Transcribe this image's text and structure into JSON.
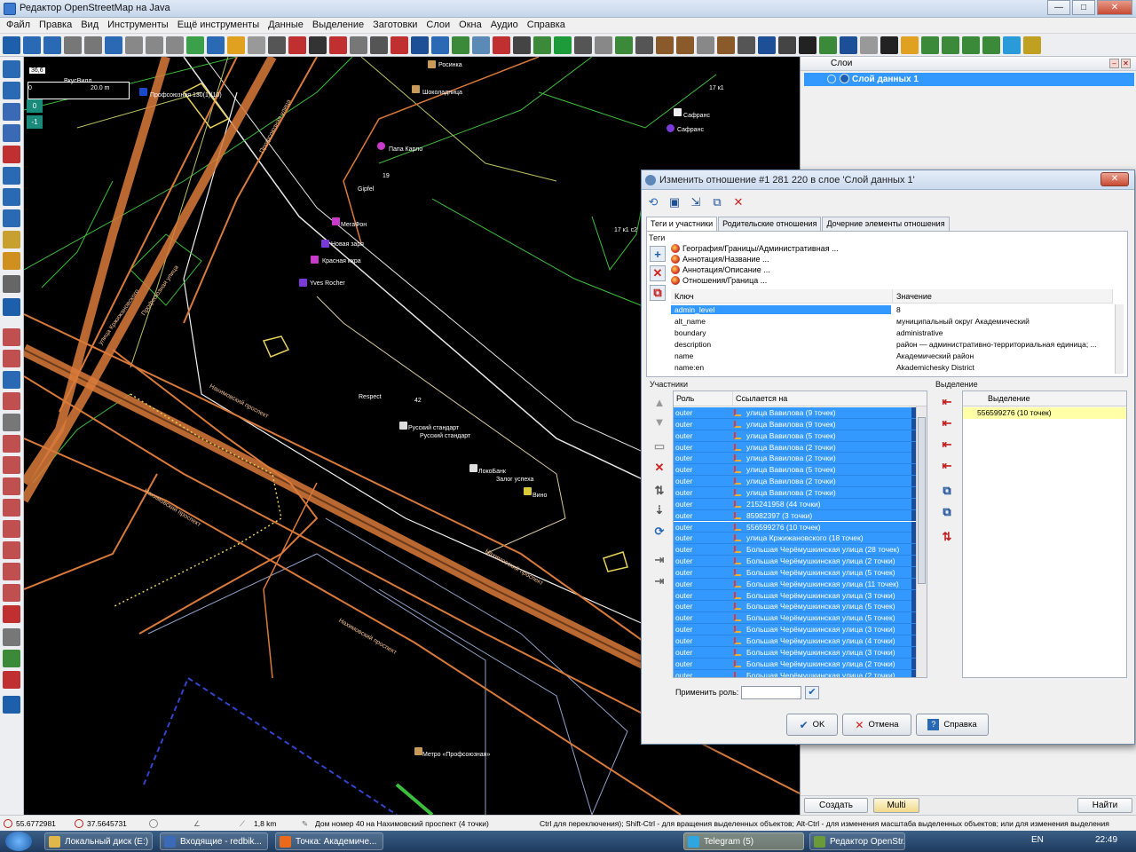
{
  "window": {
    "title": "Редактор OpenStreetMap на Java"
  },
  "menu": [
    "Файл",
    "Правка",
    "Вид",
    "Инструменты",
    "Ещё инструменты",
    "Данные",
    "Выделение",
    "Заготовки",
    "Слои",
    "Окна",
    "Аудио",
    "Справка"
  ],
  "map": {
    "scale_value": "36,6",
    "scale_zero": "0",
    "scale_len": "20.0 m",
    "zoom_in": "0",
    "zoom_out": "-1",
    "labels": {
      "vkusville": "ВкусВилл",
      "profsoyuznaya": "Профсоюзная 130(1)(10)",
      "rosinka": "Росинка",
      "shokoladnitsa": "Шоколадница",
      "papa_karlo": "Папа Карло",
      "n19": "19",
      "gipfel": "Gipfel",
      "megafon": "МегаФон",
      "novaya_zarya": "Новая заря",
      "krasnaya_ikra": "Красная икра",
      "yves_rocher": "Yves Rocher",
      "respect": "Respect",
      "n42": "42",
      "russkiy1": "Русский стандарт",
      "russkiy2": "Русский стандарт",
      "lokobank": "ЛокоБанк",
      "zalog": "Залог успеха",
      "vino": "Вино",
      "safrans1": "Сафранс",
      "safrans2": "Сафранс",
      "n17k1": "17 к1",
      "n17k1c2": "17 к1 с2",
      "metro": "Метро «Профсоюзная»",
      "street1": "Нахимовский проспект",
      "street2": "Нахимовский проспект",
      "street3": "Нахимовский проспект",
      "street4": "Нахимовский проспект",
      "street5": "Профсоюзная улица",
      "street6": "улица Кржижановского",
      "street7": "Профсоюзная улица"
    }
  },
  "layers": {
    "header": "Слои",
    "items": [
      {
        "name": "Слой данных 1"
      }
    ],
    "buttons": {
      "create": "Создать",
      "multi": "Multi",
      "find": "Найти"
    }
  },
  "dialog": {
    "title": "Изменить отношение #1 281 220 в слое 'Слой данных 1'",
    "tabs": [
      "Теги и участники",
      "Родительские отношения",
      "Дочерние элементы отношения"
    ],
    "tags_label": "Теги",
    "presets": [
      "География/Границы/Административная ...",
      "Аннотация/Название ...",
      "Аннотация/Описание ...",
      "Отношения/Граница ..."
    ],
    "tag_headers": {
      "key": "Ключ",
      "value": "Значение"
    },
    "tags": [
      {
        "k": "admin_level",
        "v": "8"
      },
      {
        "k": "alt_name",
        "v": "муниципальный округ Академический"
      },
      {
        "k": "boundary",
        "v": "administrative"
      },
      {
        "k": "description",
        "v": "район — административно-территориальная единица; ..."
      },
      {
        "k": "name",
        "v": "Академический район"
      },
      {
        "k": "name:en",
        "v": "Akademichesky District"
      }
    ],
    "members_label": "Участники",
    "member_headers": {
      "role": "Роль",
      "ref": "Ссылается на"
    },
    "members": [
      {
        "role": "outer",
        "ref": "улица Вавилова (9 точек)"
      },
      {
        "role": "outer",
        "ref": "улица Вавилова (9 точек)"
      },
      {
        "role": "outer",
        "ref": "улица Вавилова (5 точек)"
      },
      {
        "role": "outer",
        "ref": "улица Вавилова (2 точки)"
      },
      {
        "role": "outer",
        "ref": "улица Вавилова (2 точки)"
      },
      {
        "role": "outer",
        "ref": "улица Вавилова (5 точек)"
      },
      {
        "role": "outer",
        "ref": "улица Вавилова (2 точки)"
      },
      {
        "role": "outer",
        "ref": "улица Вавилова (2 точки)"
      },
      {
        "role": "outer",
        "ref": "215241958 (44 точки)"
      },
      {
        "role": "outer",
        "ref": "85982397 (3 точки)"
      },
      {
        "role": "outer",
        "ref": "556599276 (10 точек)"
      },
      {
        "role": "outer",
        "ref": "улица Кржижановского (18 точек)"
      },
      {
        "role": "outer",
        "ref": "Большая Черёмушкинская улица (28 точек)"
      },
      {
        "role": "outer",
        "ref": "Большая Черёмушкинская улица (2 точки)"
      },
      {
        "role": "outer",
        "ref": "Большая Черёмушкинская улица (5 точек)"
      },
      {
        "role": "outer",
        "ref": "Большая Черёмушкинская улица (11 точек)"
      },
      {
        "role": "outer",
        "ref": "Большая Черёмушкинская улица (3 точки)"
      },
      {
        "role": "outer",
        "ref": "Большая Черёмушкинская улица (5 точек)"
      },
      {
        "role": "outer",
        "ref": "Большая Черёмушкинская улица (5 точек)"
      },
      {
        "role": "outer",
        "ref": "Большая Черёмушкинская улица (3 точки)"
      },
      {
        "role": "outer",
        "ref": "Большая Черёмушкинская улица (4 точки)"
      },
      {
        "role": "outer",
        "ref": "Большая Черёмушкинская улица (3 точки)"
      },
      {
        "role": "outer",
        "ref": "Большая Черёмушкинская улица (2 точки)"
      },
      {
        "role": "outer",
        "ref": "Большая Черёмушкинская улица (2 точки)"
      }
    ],
    "selection_label": "Выделение",
    "selection_header": "Выделение",
    "selection": [
      "556599276 (10 точек)"
    ],
    "apply_role_label": "Применить роль:",
    "buttons": {
      "ok": "OK",
      "cancel": "Отмена",
      "help": "Справка"
    }
  },
  "status": {
    "lat": "55.6772981",
    "lon": "37.5645731",
    "distance": "1,8 km",
    "object": "Дом номер 40 на Нахимовский проспект (4 точки)",
    "hint": "Ctrl для переключения); Shift-Ctrl - для вращения выделенных объектов; Alt-Ctrl - для изменения масштаба выделенных объектов; или для изменения выделения"
  },
  "taskbar": {
    "items": [
      "Локальный диск (E:)",
      "Входящие - redbik...",
      "Точка: Академиче...",
      "Telegram (5)",
      "Редактор OpenStr..."
    ],
    "lang": "EN",
    "time": "22:49"
  },
  "colors": {
    "selection": "#3399ff",
    "map_bg": "#000000",
    "street": "#d97a3a",
    "boundary": "#3bbf3b"
  }
}
